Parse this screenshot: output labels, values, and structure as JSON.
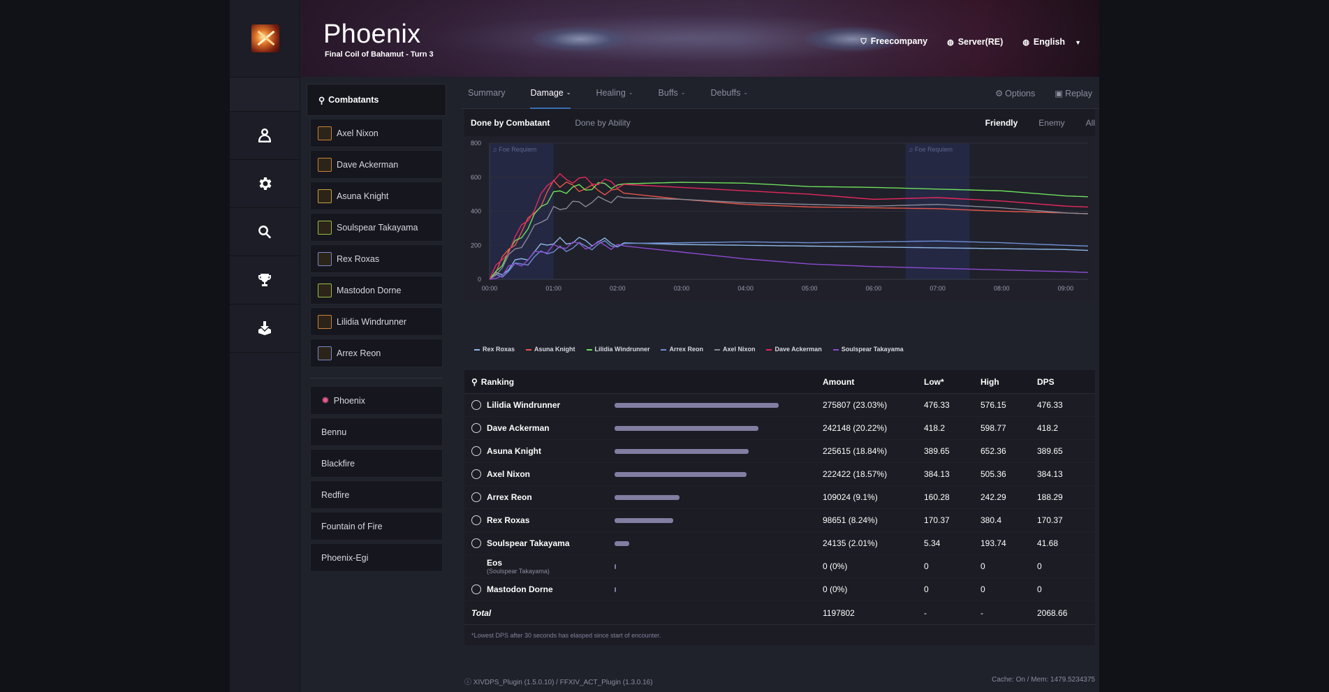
{
  "header": {
    "title": "Phoenix",
    "subtitle": "Final Coil of Bahamut - Turn 3",
    "menu": [
      {
        "icon": "shield-icon",
        "label": "Freecompany"
      },
      {
        "icon": "globe-icon",
        "label": "Server(RE)"
      },
      {
        "icon": "globe-icon",
        "label": "English"
      }
    ]
  },
  "rail": {
    "items": [
      "user-icon",
      "gear-icon",
      "search-icon",
      "trophy-icon",
      "download-icon"
    ]
  },
  "sidebar": {
    "heading": "Combatants",
    "combatants": [
      {
        "name": "Axel Nixon",
        "color": "#c9823a"
      },
      {
        "name": "Dave Ackerman",
        "color": "#c9823a"
      },
      {
        "name": "Asuna Knight",
        "color": "#c9a13a"
      },
      {
        "name": "Soulspear Takayama",
        "color": "#9bbd47"
      },
      {
        "name": "Rex Roxas",
        "color": "#7c88c9"
      },
      {
        "name": "Mastodon Dorne",
        "color": "#9bbd47"
      },
      {
        "name": "Lilidia Windrunner",
        "color": "#c9823a"
      },
      {
        "name": "Arrex Reon",
        "color": "#7c88c9"
      }
    ],
    "enemies": [
      "Phoenix",
      "Bennu",
      "Blackfire",
      "Redfire",
      "Fountain of Fire",
      "Phoenix-Egi"
    ]
  },
  "tabs": {
    "items": [
      "Summary",
      "Damage",
      "Healing",
      "Buffs",
      "Debuffs"
    ],
    "active": "Damage",
    "options": "Options",
    "replay": "Replay"
  },
  "subtabs": {
    "left": [
      "Done by Combatant",
      "Done by Ability"
    ],
    "right": [
      "Friendly",
      "Enemy",
      "All"
    ]
  },
  "chart_data": {
    "type": "line",
    "x": [
      "00:00",
      "01:00",
      "02:00",
      "03:00",
      "04:00",
      "05:00",
      "06:00",
      "07:00",
      "08:00",
      "09:00"
    ],
    "ylim": [
      0,
      800
    ],
    "yticks": [
      0,
      200,
      400,
      600,
      800
    ],
    "grid": true,
    "legend": "bottom",
    "bands": [
      {
        "label": "Foe Requiem",
        "start": "00:00",
        "end": "01:00"
      },
      {
        "label": "Foe Requiem",
        "start": "06:30",
        "end": "07:30"
      }
    ],
    "series": [
      {
        "name": "Rex Roxas",
        "color": "#8fb8e8",
        "values": [
          0,
          230,
          215,
          205,
          200,
          195,
          190,
          185,
          180,
          175
        ]
      },
      {
        "name": "Asuna Knight",
        "color": "#e8564a",
        "values": [
          0,
          560,
          510,
          470,
          440,
          425,
          420,
          415,
          400,
          390
        ]
      },
      {
        "name": "Lilidia Windrunner",
        "color": "#6ee05c",
        "values": [
          0,
          520,
          560,
          570,
          565,
          545,
          540,
          530,
          520,
          490
        ]
      },
      {
        "name": "Arrex Reon",
        "color": "#6f8fd6",
        "values": [
          0,
          180,
          210,
          215,
          220,
          215,
          220,
          225,
          215,
          200
        ]
      },
      {
        "name": "Axel Nixon",
        "color": "#8a8a98",
        "values": [
          0,
          420,
          480,
          470,
          450,
          440,
          430,
          440,
          420,
          390
        ]
      },
      {
        "name": "Dave Ackerman",
        "color": "#e8285e",
        "values": [
          0,
          600,
          560,
          540,
          520,
          500,
          470,
          480,
          460,
          430
        ]
      },
      {
        "name": "Soulspear Takayama",
        "color": "#8d4bd3",
        "values": [
          0,
          200,
          200,
          160,
          120,
          90,
          75,
          65,
          55,
          45
        ]
      }
    ]
  },
  "ranking": {
    "heading": "Ranking",
    "columns": [
      "Amount",
      "Low*",
      "High",
      "DPS"
    ],
    "rows": [
      {
        "name": "Lilidia Windrunner",
        "pct": 23.03,
        "amount": "275807 (23.03%)",
        "low": "476.33",
        "high": "576.15",
        "dps": "476.33"
      },
      {
        "name": "Dave Ackerman",
        "pct": 20.22,
        "amount": "242148 (20.22%)",
        "low": "418.2",
        "high": "598.77",
        "dps": "418.2"
      },
      {
        "name": "Asuna Knight",
        "pct": 18.84,
        "amount": "225615 (18.84%)",
        "low": "389.65",
        "high": "652.36",
        "dps": "389.65"
      },
      {
        "name": "Axel Nixon",
        "pct": 18.57,
        "amount": "222422 (18.57%)",
        "low": "384.13",
        "high": "505.36",
        "dps": "384.13"
      },
      {
        "name": "Arrex Reon",
        "pct": 9.1,
        "amount": "109024 (9.1%)",
        "low": "160.28",
        "high": "242.29",
        "dps": "188.29"
      },
      {
        "name": "Rex Roxas",
        "pct": 8.24,
        "amount": "98651 (8.24%)",
        "low": "170.37",
        "high": "380.4",
        "dps": "170.37"
      },
      {
        "name": "Soulspear Takayama",
        "pct": 2.01,
        "amount": "24135 (2.01%)",
        "low": "5.34",
        "high": "193.74",
        "dps": "41.68"
      },
      {
        "name": "Eos",
        "owner": "(Soulspear Takayama)",
        "pct": 0,
        "amount": "0 (0%)",
        "low": "0",
        "high": "0",
        "dps": "0"
      },
      {
        "name": "Mastodon Dorne",
        "pct": 0,
        "amount": "0 (0%)",
        "low": "0",
        "high": "0",
        "dps": "0"
      }
    ],
    "total": {
      "label": "Total",
      "amount": "1197802",
      "low": "-",
      "high": "-",
      "dps": "2068.66"
    },
    "footnote": "*Lowest DPS after 30 seconds has elasped since start of encounter."
  },
  "footer": {
    "left": "XIVDPS_Plugin (1.5.0.10) / FFXIV_ACT_Plugin (1.3.0.16)",
    "right": "Cache: On / Mem: 1479.5234375"
  }
}
